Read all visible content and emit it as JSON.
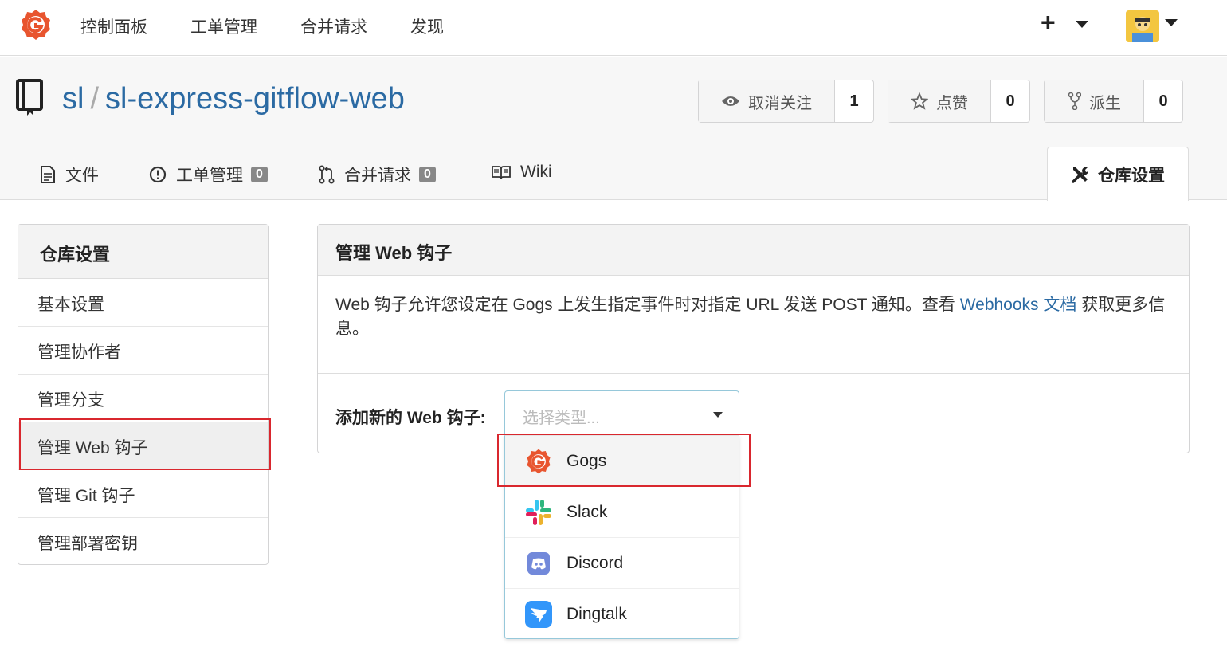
{
  "nav": {
    "items": [
      "控制面板",
      "工单管理",
      "合并请求",
      "发现"
    ],
    "plus": "+"
  },
  "repo": {
    "owner": "sl",
    "separator": "/",
    "name": "sl-express-gitflow-web",
    "watch": {
      "label": "取消关注",
      "count": "1"
    },
    "star": {
      "label": "点赞",
      "count": "0"
    },
    "fork": {
      "label": "派生",
      "count": "0"
    }
  },
  "tabs": {
    "files": "文件",
    "issues": {
      "label": "工单管理",
      "count": "0"
    },
    "pulls": {
      "label": "合并请求",
      "count": "0"
    },
    "wiki": "Wiki",
    "settings": "仓库设置"
  },
  "sidebar": {
    "title": "仓库设置",
    "items": [
      "基本设置",
      "管理协作者",
      "管理分支",
      "管理 Web 钩子",
      "管理 Git 钩子",
      "管理部署密钥"
    ],
    "active_index": 3
  },
  "panel": {
    "title": "管理 Web 钩子",
    "desc_before": "Web 钩子允许您设定在 Gogs 上发生指定事件时对指定 URL 发送 POST 通知。查看 ",
    "desc_link": "Webhooks 文档",
    "desc_after": " 获取更多信息。",
    "add_label": "添加新的 Web 钩子:",
    "select_placeholder": "选择类型..."
  },
  "webhook_types": [
    "Gogs",
    "Slack",
    "Discord",
    "Dingtalk"
  ],
  "colors": {
    "link": "#2b6aa3",
    "highlight": "#d9272e",
    "gogs": "#e8552f",
    "discord": "#7289da",
    "dingtalk": "#3296fa"
  }
}
